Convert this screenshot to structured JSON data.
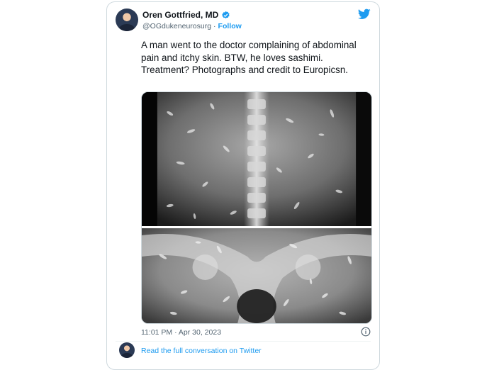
{
  "tweet": {
    "author_name": "Oren Gottfried, MD",
    "handle": "@OGdukeneurosurg",
    "separator": "·",
    "follow_label": "Follow",
    "text": "A man went to the doctor complaining of abdominal pain and itchy skin. BTW, he loves sashimi. Treatment? Photographs and credit to Europicsn.",
    "timestamp": "11:01 PM · Apr 30, 2023",
    "read_conversation_label": "Read the full conversation on Twitter"
  },
  "icons": {
    "brand": "twitter-bird-icon",
    "verified": "verified-badge-icon",
    "info": "info-icon"
  },
  "colors": {
    "accent": "#1d9bf0",
    "text": "#0f1419",
    "secondary_text": "#536471",
    "border": "#cfd9de"
  }
}
